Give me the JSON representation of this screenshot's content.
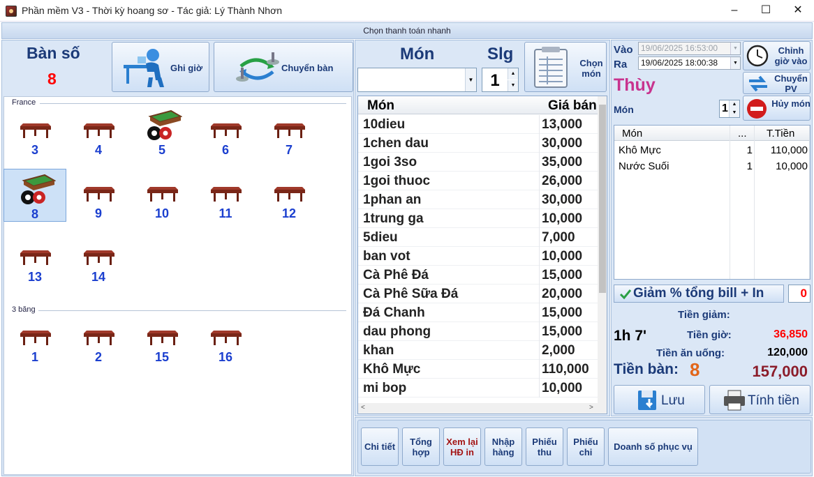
{
  "window": {
    "title": "Phần mềm V3 - Thời kỳ hoang sơ - Tác giả: Lý Thành Nhơn",
    "minimize": "–",
    "maximize": "☐",
    "close": "✕"
  },
  "quickpay_label": "Chọn thanh toán nhanh",
  "left": {
    "ban_so_label": "Bàn số",
    "ban_so_value": "8",
    "ghi_gio_label": "Ghi giờ",
    "chuyen_ban_label": "Chuyển bàn",
    "groups": [
      {
        "name": "France",
        "tables": [
          "3",
          "4",
          "5",
          "6",
          "7",
          "8",
          "9",
          "10",
          "11",
          "12",
          "13",
          "14"
        ]
      },
      {
        "name": "3 băng",
        "tables": [
          "1",
          "2",
          "15",
          "16"
        ]
      }
    ],
    "selected_table": "8",
    "occupied_tables": [
      "5",
      "8"
    ]
  },
  "middle": {
    "mon_label": "Món",
    "slg_label": "Slg",
    "qty_value": "1",
    "chon_mon_label": "Chọn món",
    "columns": {
      "name": "Món",
      "price": "Giá bán"
    },
    "items": [
      {
        "name": "10dieu",
        "price": "13,000"
      },
      {
        "name": "1chen dau",
        "price": "30,000"
      },
      {
        "name": "1goi 3so",
        "price": "35,000"
      },
      {
        "name": "1goi thuoc",
        "price": "26,000"
      },
      {
        "name": "1phan an",
        "price": "30,000"
      },
      {
        "name": "1trung ga",
        "price": "10,000"
      },
      {
        "name": "5dieu",
        "price": "7,000"
      },
      {
        "name": "ban vot",
        "price": "10,000"
      },
      {
        "name": "Cà Phê Đá",
        "price": "15,000"
      },
      {
        "name": "Cà Phê Sữa Đá",
        "price": "20,000"
      },
      {
        "name": "Đá Chanh",
        "price": "15,000"
      },
      {
        "name": "dau phong",
        "price": "15,000"
      },
      {
        "name": "khan",
        "price": "2,000"
      },
      {
        "name": "Khô Mực",
        "price": "110,000"
      },
      {
        "name": "mi bop",
        "price": "10,000"
      }
    ]
  },
  "right": {
    "vao_label": "Vào",
    "ra_label": "Ra",
    "vao_value": "19/06/2025 16:53:00",
    "ra_value": "19/06/2025 18:00:38",
    "chinh_gio_vao_label": "Chỉnh giờ vào",
    "chuyen_pv_label": "Chuyển PV",
    "huy_mon_label": "Hủy món",
    "staff_name": "Thùy",
    "mon_label": "Món",
    "mon_qty": "1",
    "order_columns": {
      "name": "Món",
      "qty": "...",
      "total": "T.Tiền"
    },
    "order_items": [
      {
        "name": "Khô Mực",
        "qty": "1",
        "total": "110,000"
      },
      {
        "name": "Nước Suối",
        "qty": "1",
        "total": "10,000"
      }
    ],
    "giam_label": "Giảm % tổng bill + In",
    "giam_value": "0",
    "tien_giam_label": "Tiền giảm:",
    "tien_giam_value": "",
    "duration": "1h 7'",
    "tien_gio_label": "Tiền giờ:",
    "tien_gio_value": "36,850",
    "tien_an_uong_label": "Tiền ăn uống:",
    "tien_an_uong_value": "120,000",
    "tien_ban_label": "Tiền  bàn:",
    "tien_ban_number": "8",
    "total_value": "157,000",
    "luu_label": "Lưu",
    "tinh_tien_label": "Tính tiền",
    "colors": {
      "red": "#ff0000",
      "orange": "#e2661a",
      "maroon": "#8b1c2a",
      "pink": "#c8338e",
      "navy": "#1b3a78"
    }
  },
  "bottom_buttons": [
    {
      "label": "Chi tiết"
    },
    {
      "label": "Tổng hợp"
    },
    {
      "label": "Xem lại HĐ in"
    },
    {
      "label": "Nhập hàng"
    },
    {
      "label": "Phiếu thu"
    },
    {
      "label": "Phiếu chi"
    },
    {
      "label": "Doanh số phục vụ"
    }
  ]
}
